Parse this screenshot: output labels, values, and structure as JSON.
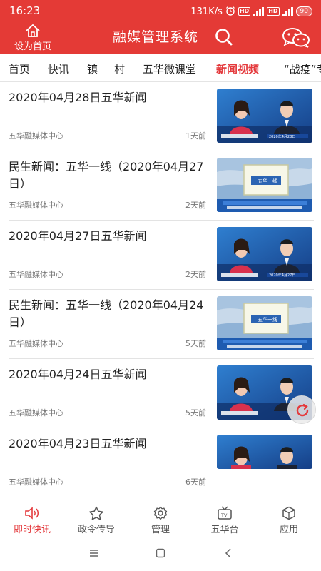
{
  "status_bar": {
    "time": "16:23",
    "net_speed": "131K/s",
    "battery": "90"
  },
  "header": {
    "home_label": "设为首页",
    "title": "融媒管理系统"
  },
  "tabs": [
    {
      "label": "首页"
    },
    {
      "label": "快讯"
    },
    {
      "label": "镇"
    },
    {
      "label": "村"
    },
    {
      "label": "五华微课堂"
    },
    {
      "label": "新闻视频"
    },
    {
      "label": "“战疫”专"
    }
  ],
  "news": [
    {
      "title": "2020年04月28日五华新闻",
      "source": "五华融媒体中心",
      "time": "1天前",
      "thumb": "anchors",
      "date_caption": "2020年4月28日"
    },
    {
      "title": "民生新闻：五华一线（2020年04月27日）",
      "source": "五华融媒体中心",
      "time": "2天前",
      "thumb": "program",
      "program_name": "五华一线"
    },
    {
      "title": "2020年04月27日五华新闻",
      "source": "五华融媒体中心",
      "time": "2天前",
      "thumb": "anchors",
      "date_caption": "2020年4月27日"
    },
    {
      "title": "民生新闻：五华一线（2020年04月24日）",
      "source": "五华融媒体中心",
      "time": "5天前",
      "thumb": "program",
      "program_name": "五华一线"
    },
    {
      "title": "2020年04月24日五华新闻",
      "source": "五华融媒体中心",
      "time": "5天前",
      "thumb": "anchors",
      "date_caption": ""
    },
    {
      "title": "2020年04月23日五华新闻",
      "source": "五华融媒体中心",
      "time": "6天前",
      "thumb": "anchors",
      "date_caption": ""
    }
  ],
  "bottom_nav": [
    {
      "label": "即时快讯",
      "icon": "speaker-icon"
    },
    {
      "label": "政令传导",
      "icon": "star-icon"
    },
    {
      "label": "管理",
      "icon": "gear-icon"
    },
    {
      "label": "五华台",
      "icon": "tv-icon"
    },
    {
      "label": "应用",
      "icon": "cube-icon"
    }
  ],
  "colors": {
    "brand_red": "#e43a36",
    "active_red": "#e4393c"
  }
}
